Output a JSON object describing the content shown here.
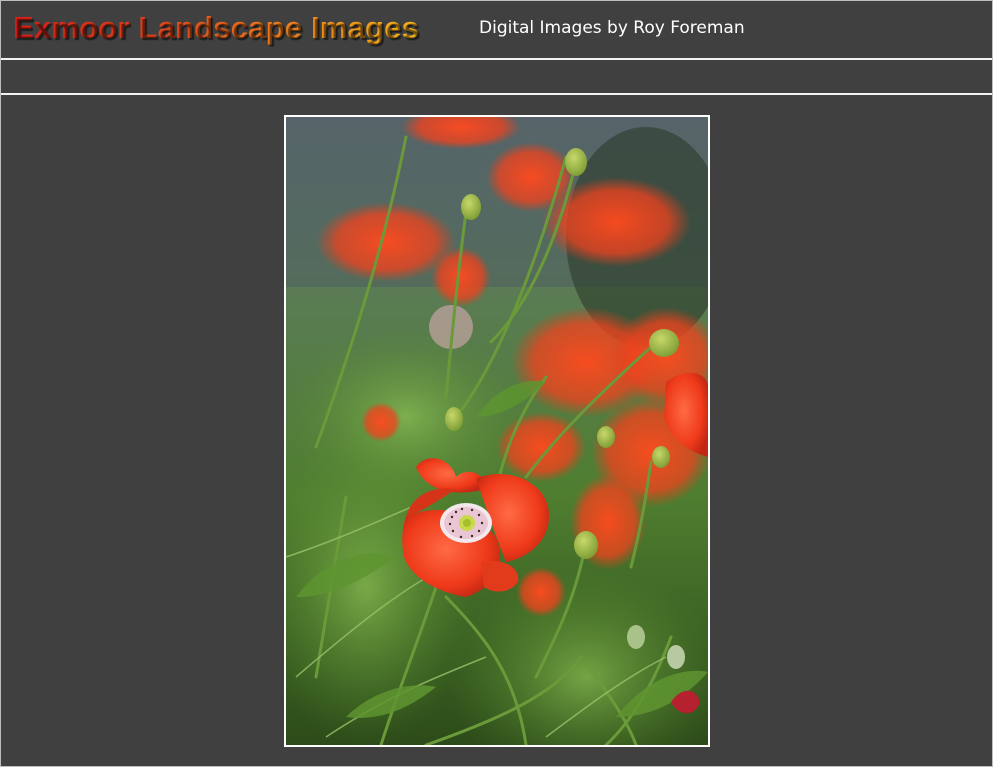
{
  "header": {
    "title": "Exmoor Landscape Images",
    "subtitle": "Digital Images by Roy Foreman"
  },
  "nav": {
    "items": []
  },
  "photo": {
    "subject": "red poppies"
  },
  "colors": {
    "background": "#404040",
    "rule": "#f2f2f2",
    "title_gradient_start": "#d81f17",
    "title_gradient_end": "#f4b51a",
    "subtitle": "#ffffff"
  }
}
